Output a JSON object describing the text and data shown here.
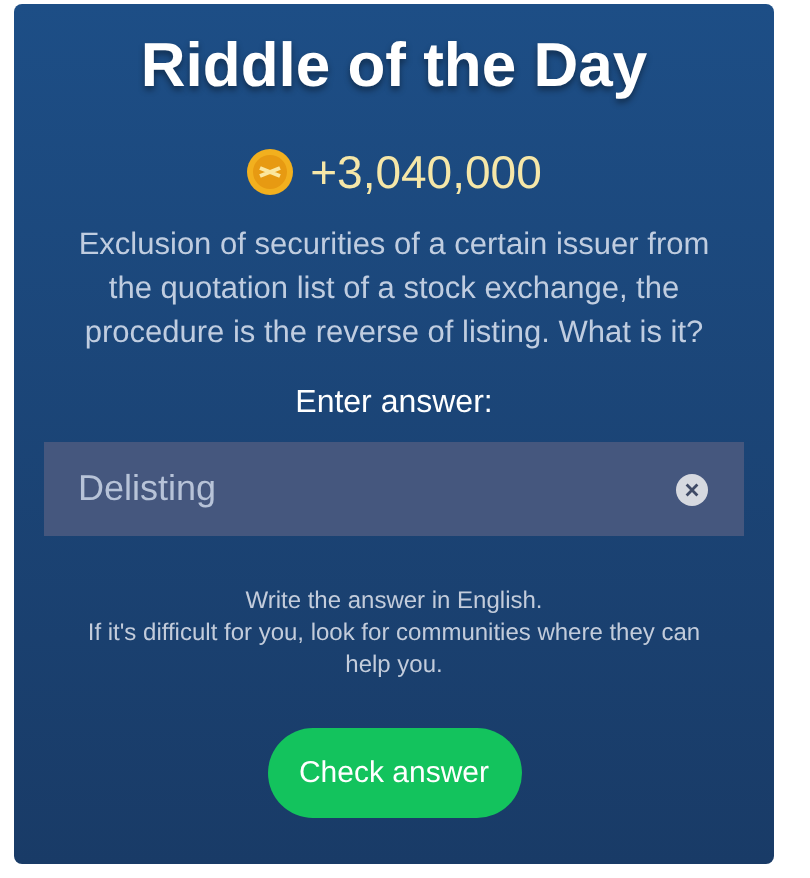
{
  "title": "Riddle of the Day",
  "reward": "+3,040,000",
  "question": "Exclusion of securities of a certain issuer from the quotation list of a stock exchange, the procedure is the reverse of listing. What is it?",
  "answer_label": "Enter answer:",
  "answer_field": {
    "value": "Delisting"
  },
  "hints": [
    "Write the answer in English.",
    "If it's difficult for you, look for communities where they can help you."
  ],
  "buttons": [
    "Check answer"
  ]
}
